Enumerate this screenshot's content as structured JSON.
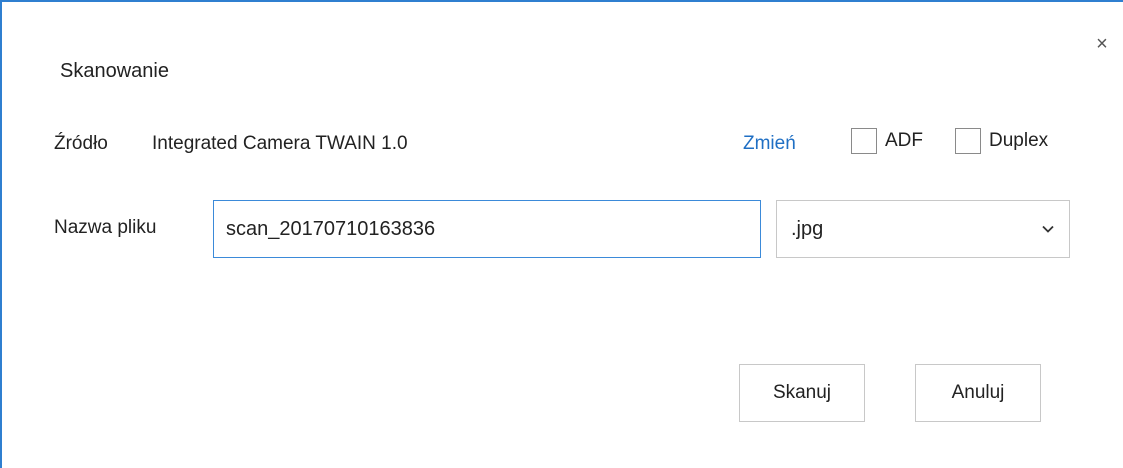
{
  "dialog": {
    "title": "Skanowanie",
    "close_symbol": "×",
    "close_icon": "close-icon"
  },
  "source": {
    "label": "Źródło",
    "value": "Integrated Camera TWAIN 1.0",
    "change_link": "Zmień"
  },
  "options": {
    "adf": {
      "label": "ADF",
      "checked": false
    },
    "duplex": {
      "label": "Duplex",
      "checked": false
    }
  },
  "filename": {
    "label": "Nazwa pliku",
    "value": "scan_20170710163836"
  },
  "extension": {
    "selected": ".jpg",
    "icon": "chevron-down-icon"
  },
  "buttons": {
    "scan": "Skanuj",
    "cancel": "Anuluj"
  },
  "colors": {
    "accent": "#2f7fd0",
    "link": "#1f6fc4",
    "input_focus_border": "#3b8ad9"
  }
}
